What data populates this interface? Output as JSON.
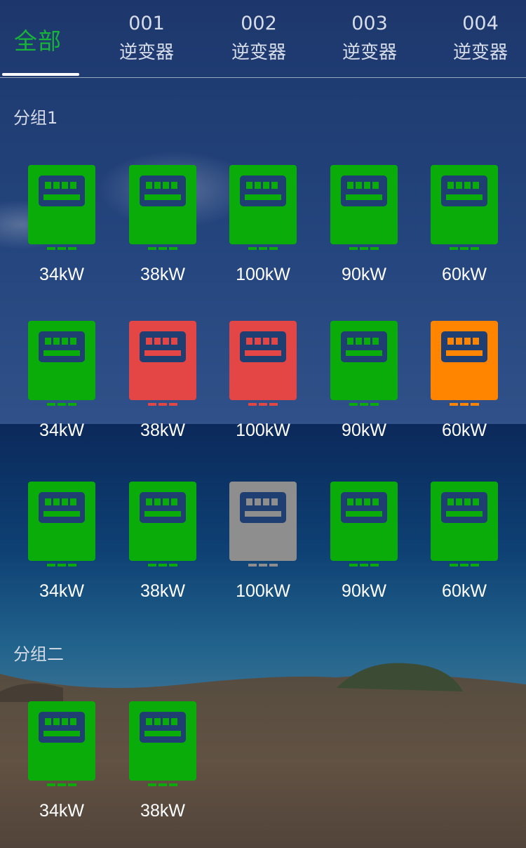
{
  "tabs": [
    {
      "number": "",
      "label": "全部",
      "active": true
    },
    {
      "number": "001",
      "label": "逆变器",
      "active": false
    },
    {
      "number": "002",
      "label": "逆变器",
      "active": false
    },
    {
      "number": "003",
      "label": "逆变器",
      "active": false
    },
    {
      "number": "004",
      "label": "逆变器",
      "active": false
    }
  ],
  "groups": [
    {
      "title": "分组1",
      "devices": [
        {
          "power": "34kW",
          "status": "green"
        },
        {
          "power": "38kW",
          "status": "green"
        },
        {
          "power": "100kW",
          "status": "green"
        },
        {
          "power": "90kW",
          "status": "green"
        },
        {
          "power": "60kW",
          "status": "green"
        },
        {
          "power": "34kW",
          "status": "green"
        },
        {
          "power": "38kW",
          "status": "red"
        },
        {
          "power": "100kW",
          "status": "red"
        },
        {
          "power": "90kW",
          "status": "green"
        },
        {
          "power": "60kW",
          "status": "orange"
        },
        {
          "power": "34kW",
          "status": "green"
        },
        {
          "power": "38kW",
          "status": "green"
        },
        {
          "power": "100kW",
          "status": "gray"
        },
        {
          "power": "90kW",
          "status": "green"
        },
        {
          "power": "60kW",
          "status": "green"
        }
      ]
    },
    {
      "title": "分组二",
      "devices": [
        {
          "power": "34kW",
          "status": "green"
        },
        {
          "power": "38kW",
          "status": "green"
        }
      ]
    }
  ],
  "status_colors": {
    "green": "#0aac0a",
    "red": "#e44545",
    "orange": "#ff8400",
    "gray": "#8e8e8e"
  },
  "tab_active_color": "#18b43a"
}
